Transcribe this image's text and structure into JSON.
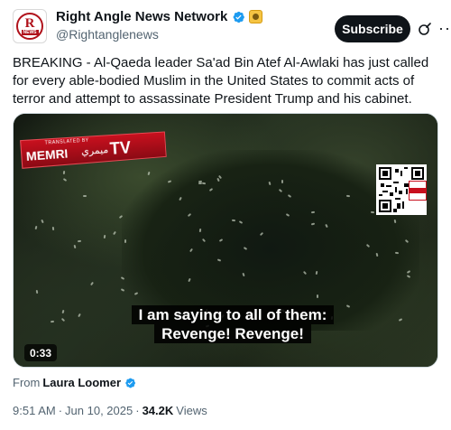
{
  "author": {
    "display_name": "Right Angle News Network",
    "handle": "@Rightanglenews",
    "avatar_text": "R",
    "avatar_subtext": "NEWS",
    "verified_icon": "verified-badge-icon",
    "affiliation_icon": "organization-badge-icon"
  },
  "actions": {
    "subscribe_label": "Subscribe",
    "grok_icon": "grok-icon",
    "more_icon": "more-icon",
    "more_glyph": "···"
  },
  "tweet": {
    "text": "BREAKING - Al-Qaeda leader Sa'ad Bin Atef Al-Awlaki has just called for every able-bodied Muslim in the United States to commit acts of terror and attempt to assassinate President Trump and his cabinet."
  },
  "media": {
    "broadcaster_small": "TRANSLATED BY",
    "broadcaster_main": "MEMRI",
    "broadcaster_arabic": "ميمري",
    "broadcaster_tv": "TV",
    "caption_line_1": "I am saying to all of them:",
    "caption_line_2": "Revenge! Revenge!",
    "duration": "0:33",
    "qr_icon": "qr-code-icon"
  },
  "attribution": {
    "prefix": "From",
    "author": "Laura Loomer",
    "verified_icon": "verified-badge-icon"
  },
  "meta": {
    "time": "9:51 AM",
    "separator": "·",
    "date": "Jun 10, 2025",
    "views_count": "34.2K",
    "views_label": "Views"
  },
  "colors": {
    "verified_blue": "#1d9bf0",
    "text_primary": "#0f1419",
    "text_secondary": "#536471",
    "memri_red": "#c8101e"
  }
}
